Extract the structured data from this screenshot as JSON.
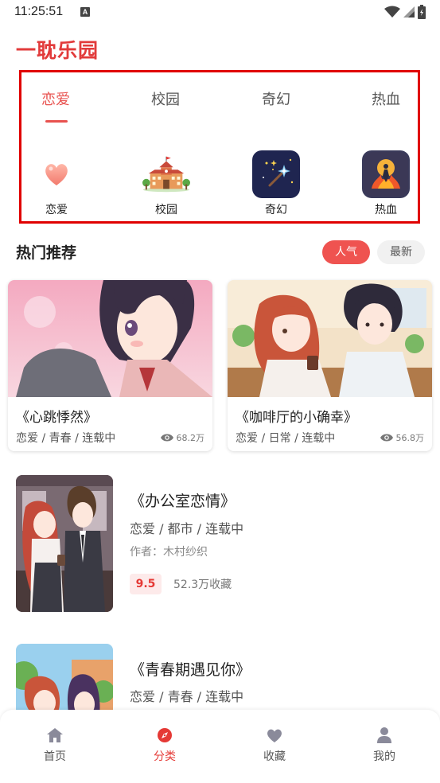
{
  "status_bar": {
    "time": "11:25:51",
    "indicator": "A"
  },
  "app": {
    "title": "一耽乐园",
    "accent_color": "#e23b3b"
  },
  "category_tabs": [
    {
      "label": "恋爱",
      "active": true
    },
    {
      "label": "校园",
      "active": false
    },
    {
      "label": "奇幻",
      "active": false
    },
    {
      "label": "热血",
      "active": false
    }
  ],
  "category_icons": [
    {
      "label": "恋爱",
      "icon": "heart-icon"
    },
    {
      "label": "校园",
      "icon": "school-icon"
    },
    {
      "label": "奇幻",
      "icon": "magic-wand-icon"
    },
    {
      "label": "热血",
      "icon": "flame-icon"
    }
  ],
  "hot_section": {
    "title": "热门推荐",
    "filters": [
      {
        "label": "人气",
        "active": true
      },
      {
        "label": "最新",
        "active": false
      }
    ]
  },
  "cards": [
    {
      "title": "《心跳悸然》",
      "tags": "恋爱 / 青春 / 连载中",
      "views": "68.2万"
    },
    {
      "title": "《咖啡厅的小确幸》",
      "tags": "恋爱 / 日常 / 连载中",
      "views": "56.8万"
    }
  ],
  "list": [
    {
      "title": "《办公室恋情》",
      "tags": "恋爱 / 都市 / 连载中",
      "author": "作者：木村纱织",
      "score": "9.5",
      "collect": "52.3万收藏"
    },
    {
      "title": "《青春期遇见你》",
      "tags": "恋爱 / 青春 / 连载中"
    }
  ],
  "bottom_nav": [
    {
      "label": "首页",
      "icon": "home-icon",
      "active": false
    },
    {
      "label": "分类",
      "icon": "compass-icon",
      "active": true
    },
    {
      "label": "收藏",
      "icon": "heart-icon",
      "active": false
    },
    {
      "label": "我的",
      "icon": "user-icon",
      "active": false
    }
  ]
}
